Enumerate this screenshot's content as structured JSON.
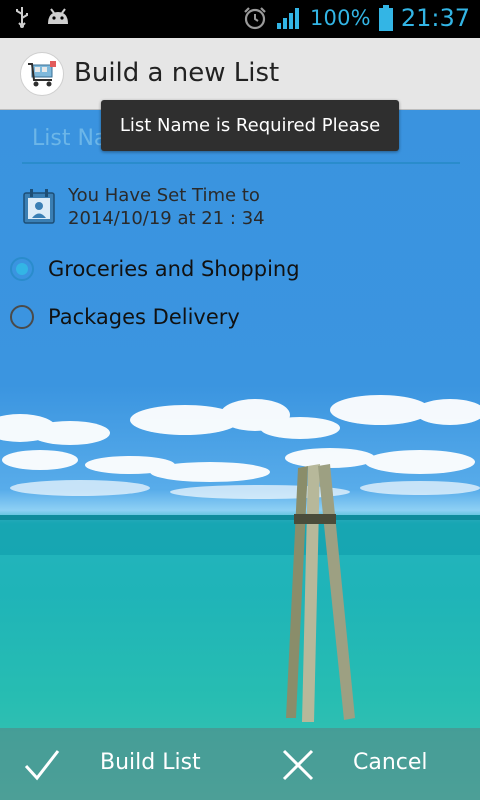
{
  "status_bar": {
    "battery_percent": "100%",
    "time": "21:37",
    "icons": [
      "usb-icon",
      "android-debug-icon",
      "alarm-icon",
      "signal-icon",
      "battery-icon"
    ]
  },
  "action_bar": {
    "title": "Build a new List",
    "app_icon": "shopping-cart-icon"
  },
  "form": {
    "list_name_placeholder": "List Name",
    "list_name_value": "",
    "time_line1": "You Have Set Time to",
    "time_line2": "2014/10/19 at 21 : 34",
    "options": [
      {
        "label": "Groceries and Shopping",
        "checked": true
      },
      {
        "label": "Packages Delivery",
        "checked": false
      }
    ]
  },
  "toast": {
    "message": "List Name is Required Please"
  },
  "bottom_bar": {
    "build_label": "Build List",
    "cancel_label": "Cancel"
  },
  "colors": {
    "accent": "#33b5e5",
    "actionbar_bg": "#e6e6e6",
    "toast_bg": "#2f2f2f"
  }
}
